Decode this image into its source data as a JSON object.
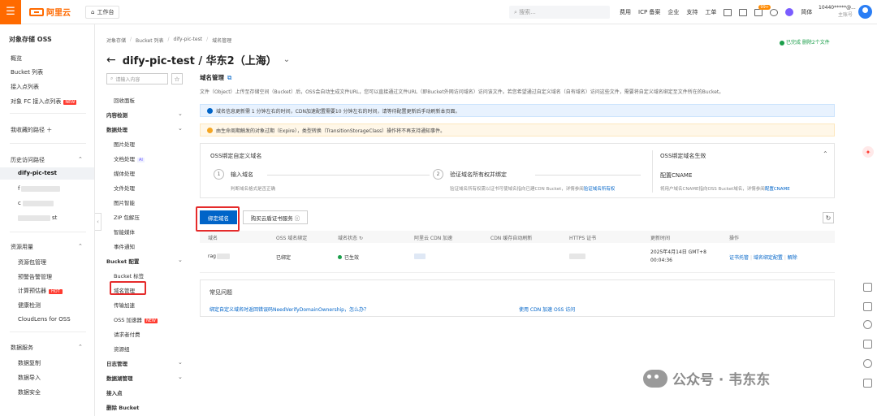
{
  "topbar": {
    "logo_text": "阿里云",
    "workbench": "工作台",
    "search_placeholder": "搜索...",
    "nav": [
      "费用",
      "ICP 备案",
      "企业",
      "支持",
      "工单"
    ],
    "badge": "99+",
    "lang": "简体",
    "account_line1": "10440*****@...",
    "account_line2": "主账号"
  },
  "sidebar": {
    "title": "对象存储 OSS",
    "items": [
      "概览",
      "Bucket 列表",
      "接入点列表",
      "对象 FC 接入点列表"
    ],
    "new_tag": "NEW",
    "fav_label": "我收藏的路径",
    "history_label": "历史访问路径",
    "history_items": [
      "dify-pic-test",
      "f",
      "c",
      "st"
    ],
    "resource_label": "资源用量",
    "resource_items": [
      "资源包管理",
      "预警告警管理",
      "计算预估器",
      "健康检测",
      "CloudLens for OSS"
    ],
    "hot_tag": "HOT",
    "data_service_label": "数据服务",
    "data_service_items": [
      "数据复制",
      "数据导入",
      "数据安全"
    ]
  },
  "breadcrumb": [
    "对象存储",
    "Bucket 列表",
    "dify-pic-test",
    "域名管理"
  ],
  "page": {
    "title": "dify-pic-test / 华东2（上海）",
    "done_status": "已完成 删除2个文件"
  },
  "subnav": {
    "search_placeholder": "请输入内容",
    "items": [
      {
        "type": "item",
        "label": "回收面板"
      },
      {
        "type": "group",
        "label": "内容检测"
      },
      {
        "type": "group",
        "label": "数据处理"
      },
      {
        "type": "item",
        "label": "图片处理"
      },
      {
        "type": "item",
        "label": "文档处理",
        "tag": "AI"
      },
      {
        "type": "item",
        "label": "媒体处理"
      },
      {
        "type": "item",
        "label": "文件处理"
      },
      {
        "type": "item",
        "label": "图片智能"
      },
      {
        "type": "item",
        "label": "ZIP 包解压"
      },
      {
        "type": "item",
        "label": "智能媒体"
      },
      {
        "type": "item",
        "label": "事件通知"
      },
      {
        "type": "group",
        "label": "Bucket 配置"
      },
      {
        "type": "item",
        "label": "Bucket 标签"
      },
      {
        "type": "item",
        "label": "域名管理"
      },
      {
        "type": "item",
        "label": "传输加速"
      },
      {
        "type": "item",
        "label": "OSS 加速器",
        "tag": "NEW"
      },
      {
        "type": "item",
        "label": "请求者付费"
      },
      {
        "type": "item",
        "label": "资源组"
      },
      {
        "type": "group",
        "label": "日志管理"
      },
      {
        "type": "group",
        "label": "数据湖管理"
      },
      {
        "type": "group",
        "label": "接入点"
      },
      {
        "type": "group",
        "label": "删除 Bucket"
      }
    ]
  },
  "main": {
    "title": "域名管理",
    "desc": "文件（Object）上传至存储空间（Bucket）后，OSS会自动生成文件URL，您可以直接通过文件URL（即Bucket外网访问域名）访问该文件。若您希望通过自定义域名（自有域名）访问这些文件，需要将自定义域名绑定至文件所在的Bucket。",
    "info": "域名信息更新需 1 分钟左右的时间，CDN加速配置需要10 分钟左右的时间，请等待配置更新后手动刷新本页面。",
    "warn": "由生命周期触发的对象过期（Expire），类型转换（TransitionStorageClass）操作将不再支持通知事件。",
    "steps_title": "OSS绑定自定义域名",
    "step1_title": "输入域名",
    "step1_desc": "判断域名格式是否正确",
    "step2_title": "验证域名所有权并绑定",
    "step2_desc": "验证域名所有权需以证书可使域名指向已建CDN Bucket，详情参阅",
    "step2_link": "验证域名所有权",
    "cname_card_title": "OSS绑定域名生效",
    "cname_title": "配置CNAME",
    "cname_desc": "将用户域名CNAME指向OSS Bucket域名，详情参阅",
    "cname_link": "配置CNAME",
    "bind_button": "绑定域名",
    "buy_cert_button": "购买云盾证书服务",
    "table_headers": [
      "域名",
      "OSS 域名绑定",
      "域名状态",
      "阿里云 CDN 加速",
      "CDN 缓存自动刷新",
      "HTTPS 证书",
      "更新时间",
      "操作"
    ],
    "row": {
      "domain": "rag",
      "binding": "已绑定",
      "status": "已生效",
      "updated": "2025年4月14日 GMT+8 00:04:36",
      "actions": [
        "证书托管",
        "域名绑定配置",
        "解除"
      ]
    },
    "faq_title": "常见问题",
    "faq_q1": "绑定自定义域名时返回错误码NeedVerifyDomainOwnership，怎么办？",
    "faq_q2": "使用 CDN 加速 OSS 访问"
  },
  "watermark": "公众号 · 韦东东"
}
